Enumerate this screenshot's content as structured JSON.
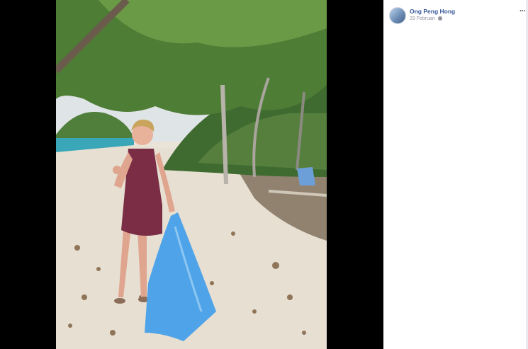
{
  "post": {
    "author": "Ong Peng Hong",
    "date": "29 Februari",
    "more_label": "···"
  },
  "icons": {
    "avatar": "profile-photo",
    "privacy": "globe-icon",
    "more": "ellipsis-icon"
  },
  "colors": {
    "author_link": "#385898",
    "meta_text": "#90949c",
    "viewer_background": "#000000",
    "panel_background": "#ffffff"
  }
}
